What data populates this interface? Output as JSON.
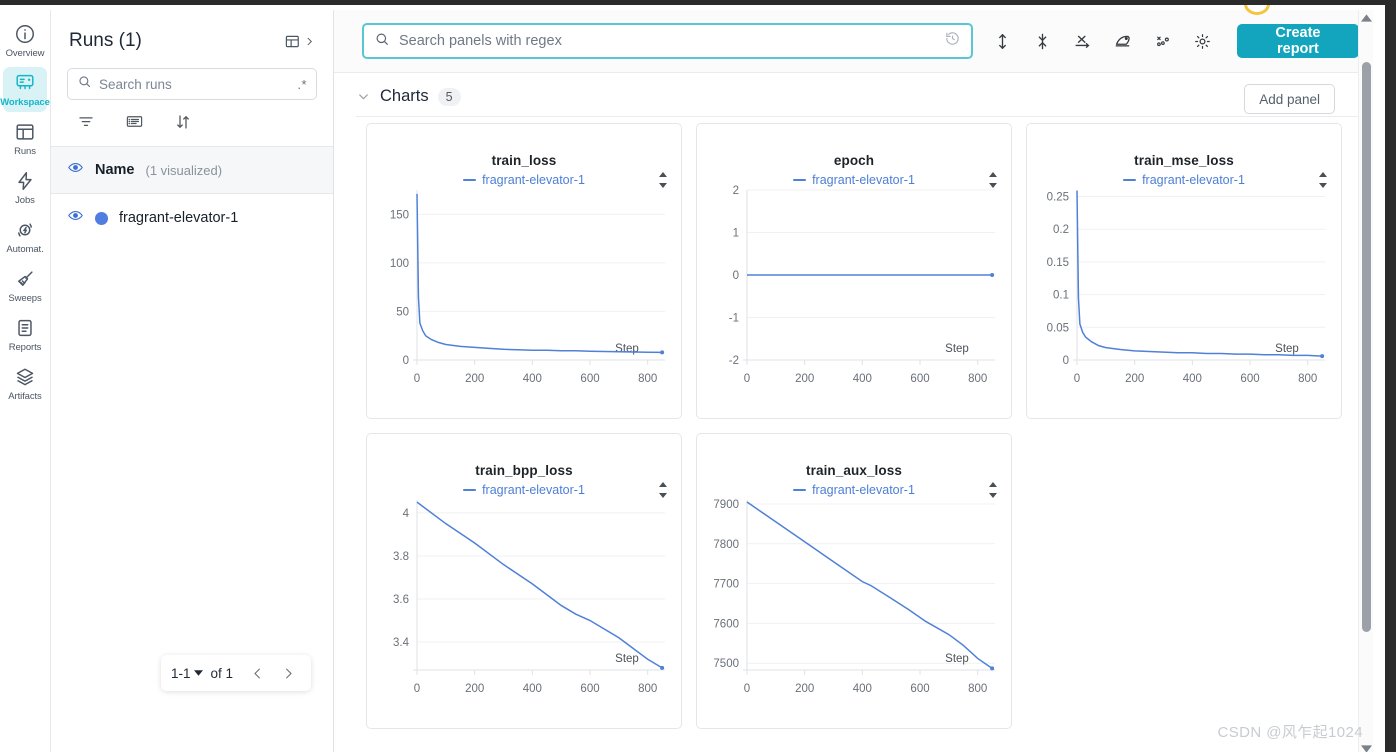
{
  "rail": {
    "items": [
      {
        "label": "Overview",
        "icon": "info-circle-icon",
        "active": false
      },
      {
        "label": "Workspace",
        "icon": "workspace-icon",
        "active": true
      },
      {
        "label": "Runs",
        "icon": "runs-table-icon",
        "active": false
      },
      {
        "label": "Jobs",
        "icon": "bolt-icon",
        "active": false
      },
      {
        "label": "Automat.",
        "icon": "automation-icon",
        "active": false
      },
      {
        "label": "Sweeps",
        "icon": "broom-icon",
        "active": false
      },
      {
        "label": "Reports",
        "icon": "clipboard-icon",
        "active": false
      },
      {
        "label": "Artifacts",
        "icon": "layers-icon",
        "active": false
      }
    ]
  },
  "runs_panel": {
    "title": "Runs (1)",
    "collapse_icon": "table-collapse-icon",
    "search": {
      "value": "",
      "placeholder": "Search runs",
      "regex_badge": ".*",
      "icon": "search-icon"
    },
    "tools": [
      {
        "name": "filter-icon",
        "label": "Filter"
      },
      {
        "name": "columns-icon",
        "label": "Columns"
      },
      {
        "name": "sort-icon",
        "label": "Sort"
      }
    ],
    "column_header": {
      "name": "Name",
      "sub": "(1 visualized)",
      "eye_icon": "eye-icon"
    },
    "rows": [
      {
        "name": "fragrant-elevator-1",
        "color": "#4f7ee0",
        "eye_icon": "eye-icon"
      }
    ],
    "pager": {
      "range": "1-1",
      "of": "of 1",
      "prev_icon": "chevron-left-icon",
      "next_icon": "chevron-right-icon"
    }
  },
  "toolbar": {
    "search": {
      "value": "",
      "placeholder": "Search panels with regex",
      "icon": "search-icon"
    },
    "icons": [
      {
        "name": "history-icon"
      },
      {
        "name": "resize-height-icon"
      },
      {
        "name": "collapse-vertical-icon"
      },
      {
        "name": "x-axis-icon"
      },
      {
        "name": "smoothing-icon"
      },
      {
        "name": "scatter-points-icon"
      },
      {
        "name": "gear-icon"
      }
    ],
    "create_report_label": "Create report",
    "accent_color": "#13a5bd"
  },
  "section": {
    "chevron_icon": "chevron-down-icon",
    "title": "Charts",
    "count": "5",
    "add_panel_label": "Add panel"
  },
  "chart_data": [
    {
      "type": "line",
      "title": "train_loss",
      "legend": [
        "fragrant-elevator-1"
      ],
      "legend_position": "top-center",
      "xlabel": "Step",
      "ylabel": "",
      "xticks": [
        "0",
        "200",
        "400",
        "600",
        "800"
      ],
      "yticks": [
        "0",
        "50",
        "100",
        "150"
      ],
      "xlim": [
        0,
        860
      ],
      "ylim": [
        0,
        175
      ],
      "grid": true,
      "series": [
        {
          "name": "fragrant-elevator-1",
          "color": "#5080d8",
          "x": [
            0,
            5,
            10,
            20,
            30,
            50,
            75,
            100,
            150,
            200,
            250,
            300,
            350,
            400,
            450,
            500,
            550,
            600,
            650,
            700,
            750,
            800,
            850
          ],
          "values": [
            171,
            65,
            38,
            30,
            25,
            21,
            18,
            16,
            14,
            13,
            12,
            11,
            10.5,
            10,
            10,
            9.5,
            9.5,
            9,
            8.8,
            8.5,
            8.2,
            8,
            7.8
          ]
        }
      ]
    },
    {
      "type": "line",
      "title": "epoch",
      "legend": [
        "fragrant-elevator-1"
      ],
      "legend_position": "top-center",
      "xlabel": "Step",
      "ylabel": "",
      "xticks": [
        "0",
        "200",
        "400",
        "600",
        "800"
      ],
      "yticks": [
        "-2",
        "-1",
        "0",
        "1",
        "2"
      ],
      "xlim": [
        0,
        860
      ],
      "ylim": [
        -2,
        2
      ],
      "grid": true,
      "series": [
        {
          "name": "fragrant-elevator-1",
          "color": "#5080d8",
          "x": [
            0,
            200,
            400,
            600,
            850
          ],
          "values": [
            0,
            0,
            0,
            0,
            0
          ]
        }
      ]
    },
    {
      "type": "line",
      "title": "train_mse_loss",
      "legend": [
        "fragrant-elevator-1"
      ],
      "legend_position": "top-center",
      "xlabel": "Step",
      "ylabel": "",
      "xticks": [
        "0",
        "200",
        "400",
        "600",
        "800"
      ],
      "yticks": [
        "0",
        "0.05",
        "0.1",
        "0.15",
        "0.2",
        "0.25"
      ],
      "xlim": [
        0,
        860
      ],
      "ylim": [
        0,
        0.26
      ],
      "grid": true,
      "series": [
        {
          "name": "fragrant-elevator-1",
          "color": "#5080d8",
          "x": [
            0,
            5,
            10,
            20,
            30,
            50,
            75,
            100,
            150,
            200,
            250,
            300,
            350,
            400,
            450,
            500,
            550,
            600,
            650,
            700,
            750,
            800,
            850
          ],
          "values": [
            0.259,
            0.095,
            0.055,
            0.042,
            0.035,
            0.028,
            0.022,
            0.019,
            0.016,
            0.014,
            0.013,
            0.012,
            0.011,
            0.011,
            0.01,
            0.01,
            0.009,
            0.009,
            0.008,
            0.008,
            0.007,
            0.007,
            0.006
          ]
        }
      ]
    },
    {
      "type": "line",
      "title": "train_bpp_loss",
      "legend": [
        "fragrant-elevator-1"
      ],
      "legend_position": "top-center",
      "xlabel": "Step",
      "ylabel": "",
      "xticks": [
        "0",
        "200",
        "400",
        "600",
        "800"
      ],
      "yticks": [
        "3.4",
        "3.6",
        "3.8",
        "4"
      ],
      "xlim": [
        0,
        860
      ],
      "ylim": [
        3.27,
        4.06
      ],
      "grid": true,
      "series": [
        {
          "name": "fragrant-elevator-1",
          "color": "#5080d8",
          "x": [
            0,
            100,
            200,
            300,
            400,
            430,
            500,
            550,
            600,
            700,
            750,
            800,
            850
          ],
          "values": [
            4.05,
            3.95,
            3.86,
            3.76,
            3.67,
            3.64,
            3.57,
            3.53,
            3.5,
            3.42,
            3.37,
            3.32,
            3.28
          ]
        }
      ]
    },
    {
      "type": "line",
      "title": "train_aux_loss",
      "legend": [
        "fragrant-elevator-1"
      ],
      "legend_position": "top-center",
      "xlabel": "Step",
      "ylabel": "",
      "xticks": [
        "0",
        "200",
        "400",
        "600",
        "800"
      ],
      "yticks": [
        "7500",
        "7600",
        "7700",
        "7800",
        "7900"
      ],
      "xlim": [
        0,
        860
      ],
      "ylim": [
        7483,
        7910
      ],
      "grid": true,
      "series": [
        {
          "name": "fragrant-elevator-1",
          "color": "#5080d8",
          "x": [
            0,
            100,
            200,
            300,
            400,
            430,
            500,
            560,
            620,
            700,
            750,
            800,
            850
          ],
          "values": [
            7905,
            7855,
            7805,
            7755,
            7705,
            7695,
            7663,
            7635,
            7605,
            7572,
            7545,
            7512,
            7487
          ]
        }
      ]
    }
  ],
  "watermark": "CSDN @风乍起1024"
}
